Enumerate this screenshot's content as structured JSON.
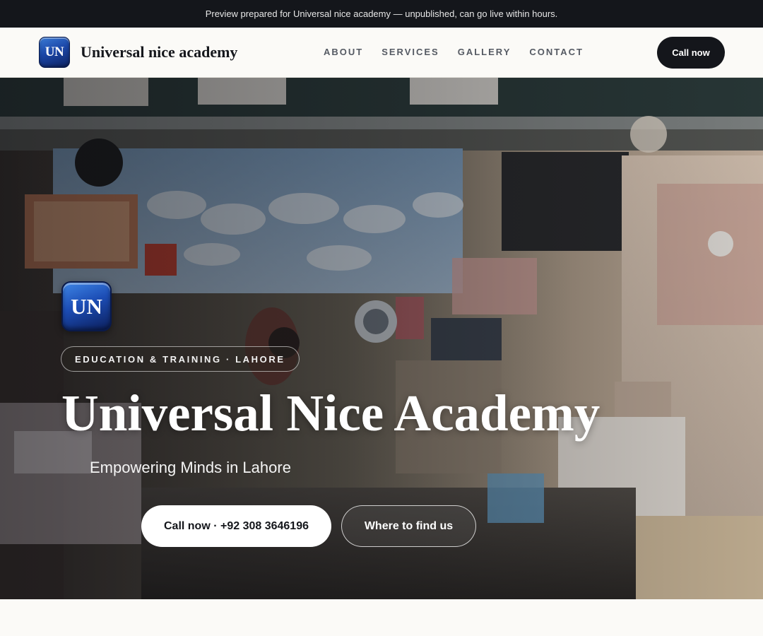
{
  "banner": {
    "text": "Preview prepared for Universal nice academy — unpublished, can go live within hours."
  },
  "header": {
    "logo_text": "UN",
    "brand_name": "Universal nice academy",
    "nav": [
      "ABOUT",
      "SERVICES",
      "GALLERY",
      "CONTACT"
    ],
    "call_label": "Call now"
  },
  "hero": {
    "logo_text": "UN",
    "tag": "EDUCATION & TRAINING · LAHORE",
    "title": "Universal Nice Academy",
    "subtitle": "Empowering Minds in Lahore",
    "primary_cta": "Call now · +92 308 3646196",
    "secondary_cta": "Where to find us"
  },
  "colors": {
    "dark": "#14161b",
    "accent_blue": "#1b47a8",
    "page_bg": "#fbfaf7"
  }
}
